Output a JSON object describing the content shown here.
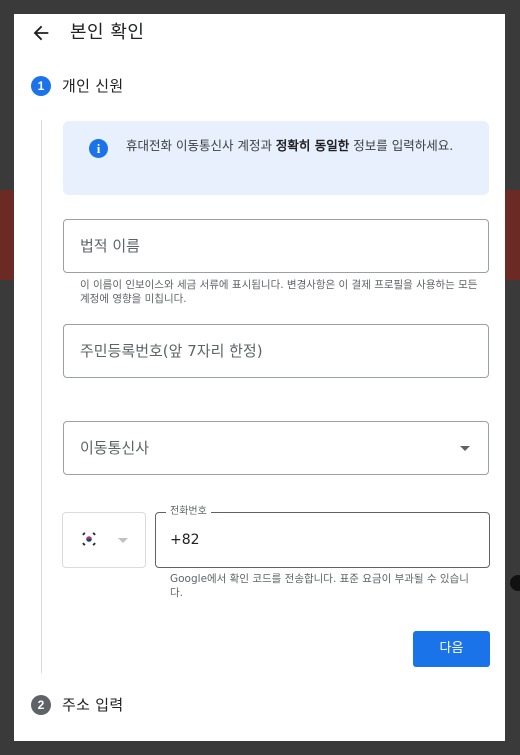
{
  "header": {
    "title": "본인 확인",
    "back_icon": "arrow-back-icon"
  },
  "steps": [
    {
      "number": "1",
      "label": "개인 신원"
    },
    {
      "number": "2",
      "label": "주소 입력"
    }
  ],
  "info": {
    "icon_text": "i",
    "text_pre": "휴대전화 이동통신사 계정과 ",
    "text_bold": "정확히 동일한",
    "text_post": " 정보를 입력하세요."
  },
  "form": {
    "legal_name": {
      "placeholder": "법적 이름",
      "helper": "이 이름이 인보이스와 세금 서류에 표시됩니다. 변경사항은 이 결제 프로필을 사용하는 모든 계정에 영향을 미칩니다."
    },
    "rrn": {
      "placeholder": "주민등록번호(앞 7자리 한정)"
    },
    "carrier": {
      "placeholder": "이동통신사"
    },
    "phone": {
      "country_flag": "kr-flag-icon",
      "label": "전화번호",
      "value": "+82",
      "helper": "Google에서 확인 코드를 전송합니다. 표준 요금이 부과될 수 있습니다."
    }
  },
  "actions": {
    "next_label": "다음"
  },
  "colors": {
    "accent": "#1a73e8",
    "info_bg": "#e8f0fe",
    "step_inactive": "#5f6368"
  }
}
